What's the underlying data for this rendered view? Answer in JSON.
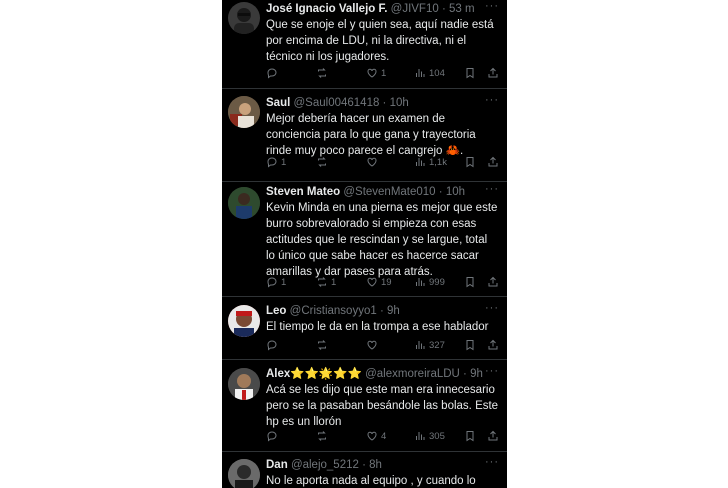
{
  "tweets": [
    {
      "name": "José Ignacio Vallejo F.",
      "handle": "@JIVF10",
      "time": "53 m",
      "text": "Que se enoje el y quien sea, aquí nadie está por encima de LDU, ni la directiva, ni el técnico ni los jugadores.",
      "replies": "",
      "retweets": "",
      "likes": "1",
      "views": "104"
    },
    {
      "name": "Saul",
      "handle": "@Saul00461418",
      "time": "10h",
      "text": "Mejor debería hacer un examen de conciencia para lo que gana y trayectoria rinde muy poco parece el cangrejo 🦀.",
      "replies": "1",
      "retweets": "",
      "likes": "",
      "views": "1,1k"
    },
    {
      "name": "Steven Mateo",
      "handle": "@StevenMate010",
      "time": "10h",
      "text": "Kevin Minda en una pierna es mejor que este burro sobrevalorado si empieza con esas actitudes que le rescindan y se largue, total lo único que sabe hacer es hacerce sacar amarillas y dar pases para atrás.",
      "replies": "1",
      "retweets": "1",
      "likes": "19",
      "views": "999"
    },
    {
      "name": "Leo",
      "handle": "@Cristiansoyyo1",
      "time": "9h",
      "text": "El tiempo le da en la trompa a ese hablador",
      "replies": "",
      "retweets": "",
      "likes": "",
      "views": "327"
    },
    {
      "name": "Alex⭐⭐🌟⭐⭐",
      "handle": "@alexmoreiraLDU",
      "time": "9h",
      "text": "Acá se les dijo que este man era innecesario pero se la pasaban besándole las bolas. Este hp es un llorón",
      "replies": "",
      "retweets": "",
      "likes": "4",
      "views": "305"
    },
    {
      "name": "Dan",
      "handle": "@alejo_5212",
      "time": "8h",
      "text": "No le aporta nada al equipo , y cuando lo",
      "replies": "",
      "retweets": "",
      "likes": "",
      "views": ""
    }
  ],
  "separator": " · ",
  "more_glyph": "···",
  "colors": {
    "background": "#000000",
    "text": "#e7e9ea",
    "muted": "#71767b",
    "divider": "#2f3336"
  },
  "icons": [
    "reply-icon",
    "retweet-icon",
    "like-icon",
    "views-icon",
    "bookmark-icon",
    "share-icon"
  ]
}
